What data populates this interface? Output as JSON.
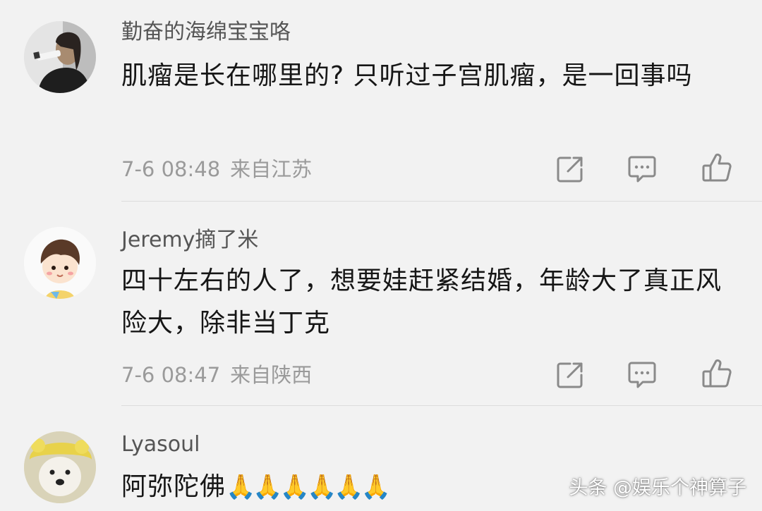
{
  "comments": [
    {
      "username": "勤奋的海绵宝宝咯",
      "text": "肌瘤是长在哪里的? 只听过子宫肌瘤，是一回事吗",
      "time": "7-6 08:48",
      "location": "来自江苏",
      "avatar_icon": "man-drinking-avatar"
    },
    {
      "username": "Jeremy摘了米",
      "text": "四十左右的人了，想要娃赶紧结婚，年龄大了真正风险大，除非当丁克",
      "time": "7-6 08:47",
      "location": "来自陕西",
      "avatar_icon": "cartoon-boy-avatar"
    },
    {
      "username": "Lyasoul",
      "text": "阿弥陀佛",
      "emoji": "🙏🙏🙏🙏🙏🙏",
      "avatar_icon": "dog-with-hat-avatar"
    }
  ],
  "actions": {
    "share_icon": "share-icon",
    "reply_icon": "reply-comment-icon",
    "like_icon": "thumbs-up-icon"
  },
  "watermark": "头条 @娱乐个神算子",
  "colors": {
    "background": "#f2f2f2",
    "text": "#161616",
    "username": "#555555",
    "meta": "#9a9a9a",
    "icon": "#8a8a8a"
  }
}
